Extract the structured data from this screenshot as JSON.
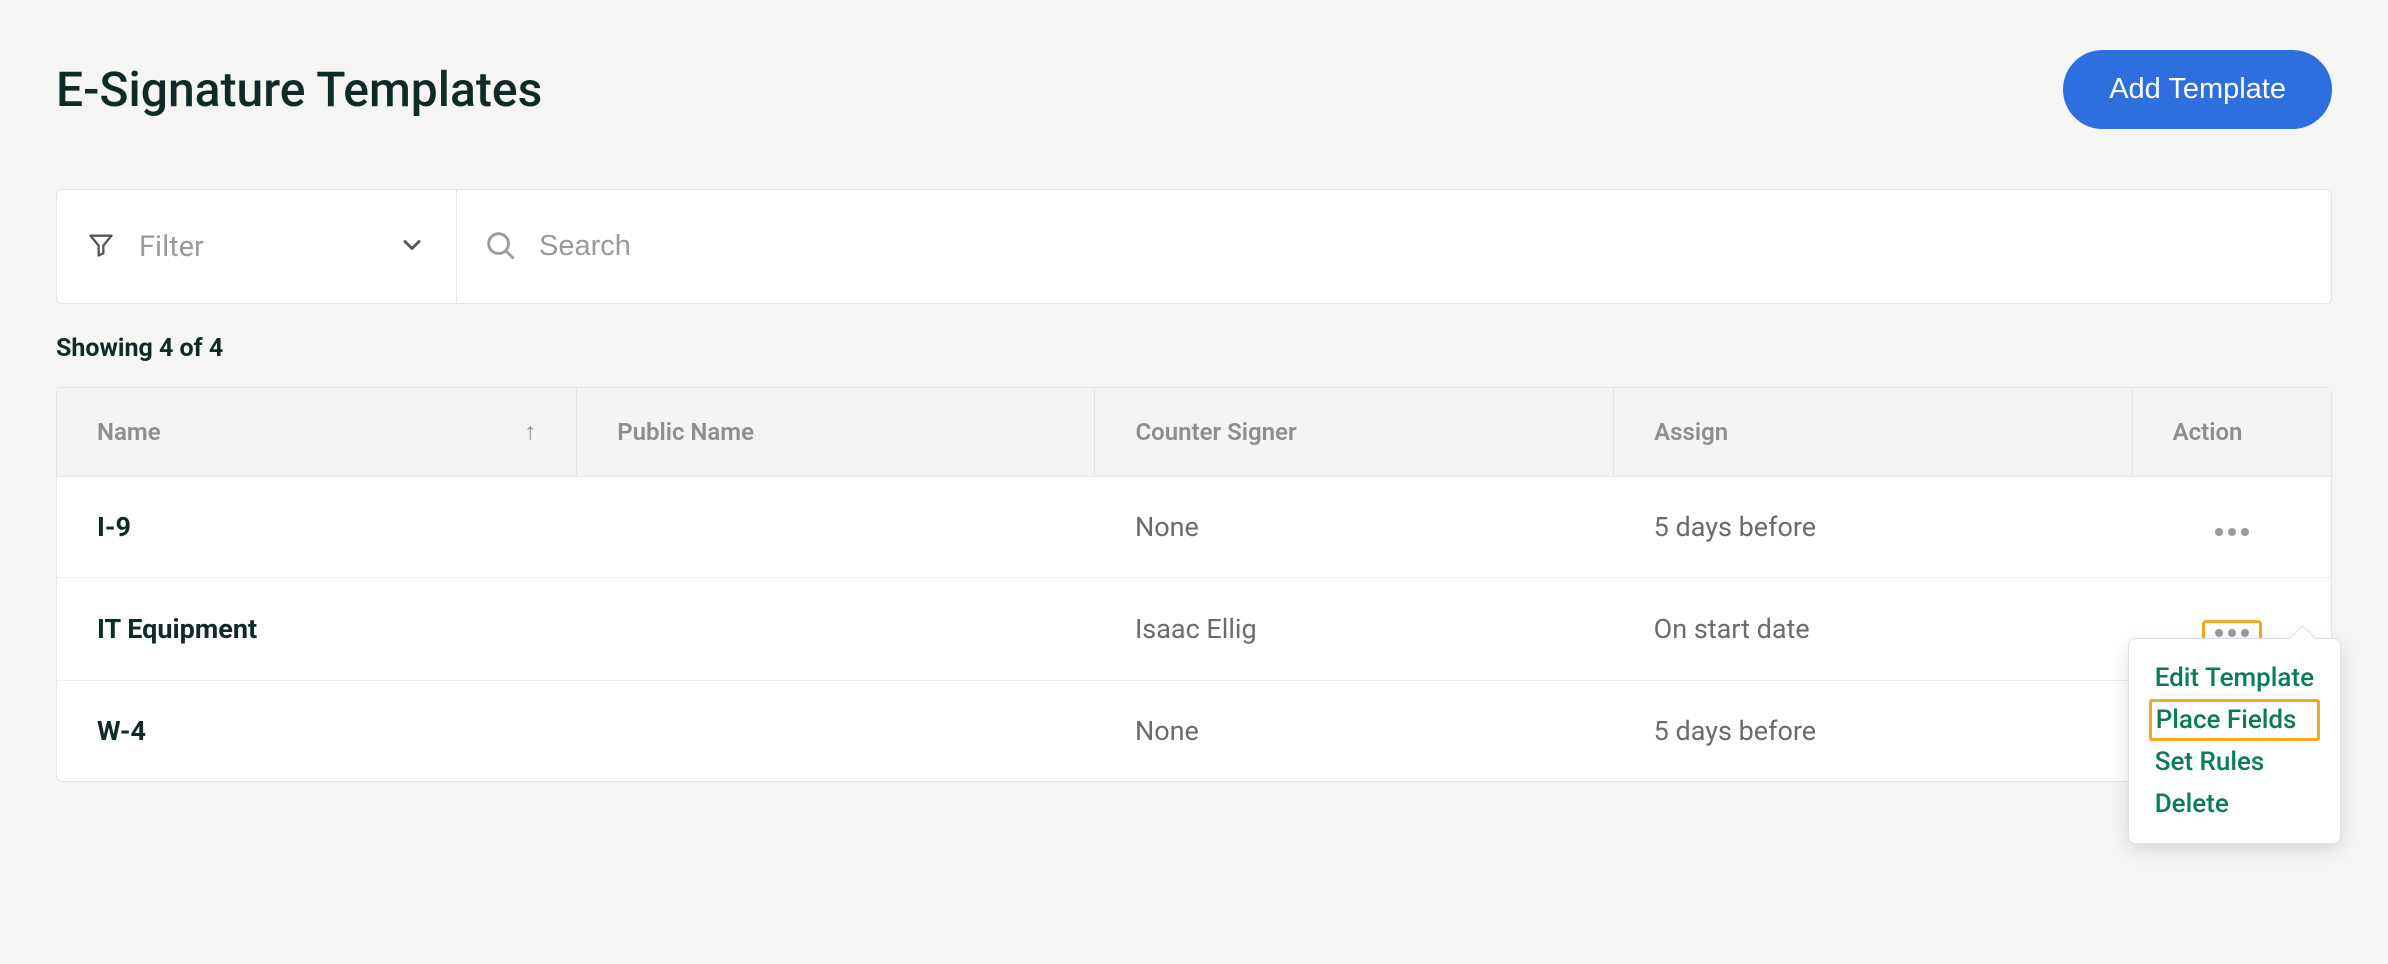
{
  "header": {
    "title": "E-Signature Templates",
    "add_button": "Add Template"
  },
  "filter": {
    "placeholder": "Filter"
  },
  "search": {
    "placeholder": "Search"
  },
  "results_summary": "Showing 4 of 4",
  "table": {
    "headers": {
      "name": "Name",
      "public_name": "Public Name",
      "counter_signer": "Counter Signer",
      "assign": "Assign",
      "action": "Action"
    },
    "sort_arrow": "↑",
    "rows": [
      {
        "name": "I-9",
        "public_name": "",
        "counter_signer": "None",
        "assign": "5 days before"
      },
      {
        "name": "IT Equipment",
        "public_name": "",
        "counter_signer": "Isaac Ellig",
        "assign": "On start date"
      },
      {
        "name": "W-4",
        "public_name": "",
        "counter_signer": "None",
        "assign": "5 days before"
      }
    ]
  },
  "popover": {
    "edit_template": "Edit Template",
    "place_fields": "Place Fields",
    "set_rules": "Set Rules",
    "delete": "Delete"
  }
}
